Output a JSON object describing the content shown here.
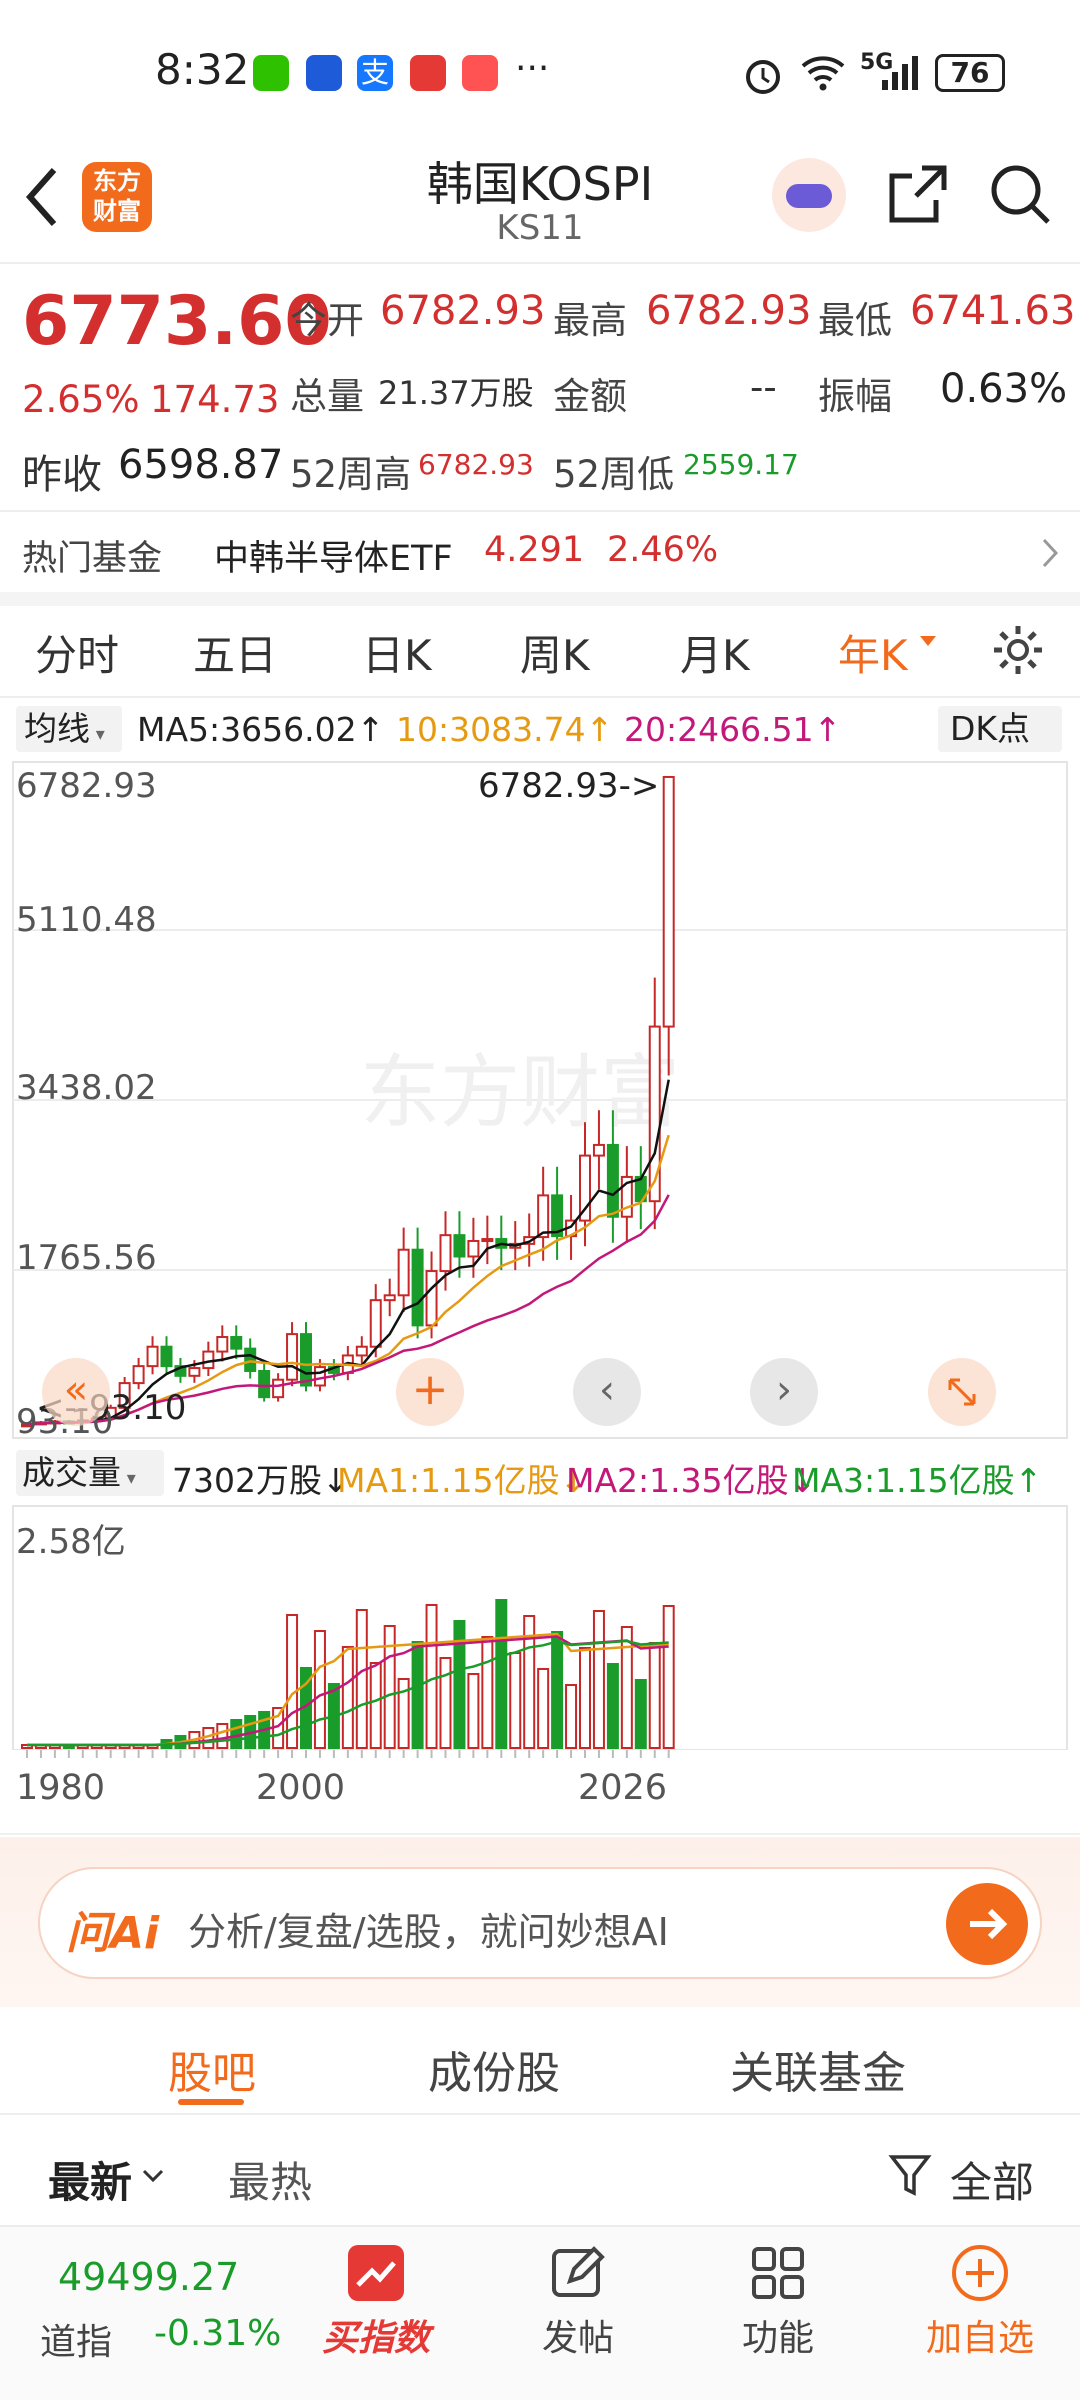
{
  "status_bar": {
    "time": "8:32",
    "battery": "76",
    "more": "···",
    "network": "5G"
  },
  "header": {
    "title": "韩国KOSPI",
    "subtitle": "KS11",
    "logo_text_1": "东方",
    "logo_text_2": "财富"
  },
  "quote": {
    "price": "6773.60",
    "change_pct": "2.65%",
    "change_abs": "174.73",
    "prev_close_label": "昨收",
    "prev_close": "6598.87",
    "open_label": "今开",
    "open": "6782.93",
    "high_label": "最高",
    "high": "6782.93",
    "low_label": "最低",
    "low": "6741.63",
    "volume_label": "总量",
    "volume": "21.37万股",
    "amount_label": "金额",
    "amount": "--",
    "amplitude_label": "振幅",
    "amplitude": "0.63%",
    "wk52_high_label": "52周高",
    "wk52_high": "6782.93",
    "wk52_low_label": "52周低",
    "wk52_low": "2559.17"
  },
  "hot_fund": {
    "label": "热门基金",
    "name": "中韩半导体ETF",
    "price": "4.291",
    "change": "2.46%"
  },
  "period_tabs": [
    "分时",
    "五日",
    "日K",
    "周K",
    "月K",
    "年K"
  ],
  "active_tab": "年K",
  "ma_bar": {
    "selector": "均线",
    "ma5": "MA5:3656.02↑",
    "ma10": "10:3083.74↑",
    "ma20": "20:2466.51↑",
    "dk_label": "DK点"
  },
  "price_chart": {
    "y_labels": [
      "6782.93",
      "5110.48",
      "3438.02",
      "1765.56",
      "93.10"
    ],
    "max_annotation": "6782.93->",
    "min_annotation": "<--93.10",
    "watermark": "东方财富"
  },
  "volume_bar": {
    "selector": "成交量",
    "vol": "7302万股↓",
    "ma1": "MA1:1.15亿股↓",
    "ma2": "MA2:1.35亿股↓",
    "ma3": "MA3:1.15亿股↑"
  },
  "volume_chart": {
    "y_max_label": "2.58亿"
  },
  "x_axis": [
    "1980",
    "2000",
    "2026"
  ],
  "ai_bar": {
    "brand": "问Ai",
    "placeholder": "分析/复盘/选股，就问妙想AI"
  },
  "section_tabs": [
    "股吧",
    "成份股",
    "关联基金"
  ],
  "active_section": "股吧",
  "filter": {
    "latest": "最新",
    "hot": "最热",
    "all": "全部"
  },
  "bottom_nav": {
    "index_value": "49499.27",
    "index_name": "道指",
    "index_change": "-0.31%",
    "buy_index": "买指数",
    "post": "发帖",
    "function": "功能",
    "add_watch": "加自选"
  },
  "colors": {
    "accent": "#f26b1d",
    "up": "#d32f2f",
    "down": "#1a9c2a"
  },
  "chart_data": {
    "type": "candlestick",
    "x_range": [
      1980,
      2026
    ],
    "y_range": [
      93.1,
      6782.93
    ],
    "notable": {
      "max": 6782.93,
      "min": 93.1
    }
  }
}
